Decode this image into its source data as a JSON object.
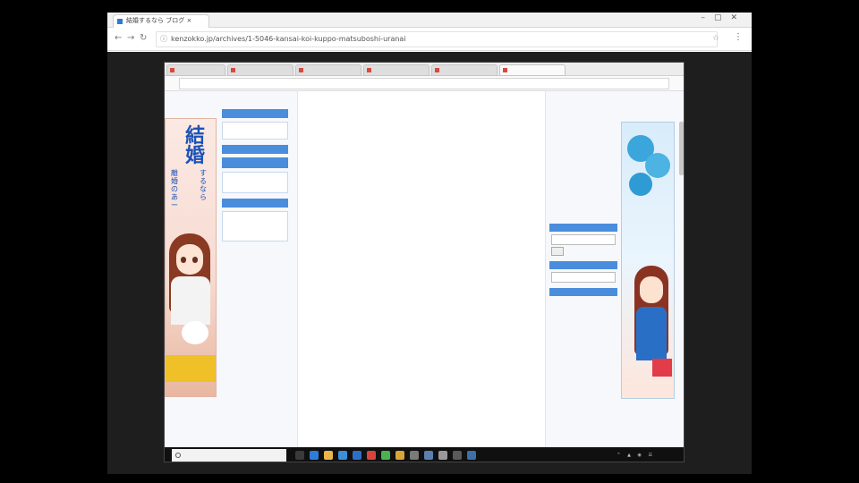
{
  "outer_browser": {
    "tab_title": "結婚するなら ブログ ×",
    "url": "kenzokko.jp/archives/1-5046-kansai-koi-kuppo-matsuboshi-uranai"
  },
  "inner_browser": {
    "tabs": [
      "",
      "",
      "",
      "",
      "",
      ""
    ],
    "url": ""
  },
  "left_banner": {
    "headline": "結婚",
    "subline": "するなら",
    "side_text": "離婚のあー",
    "bubble": "",
    "bottom_text": "",
    "caption": ""
  },
  "left_nav": {
    "headers": [
      "",
      "",
      ""
    ],
    "items": [
      "",
      "",
      "",
      "",
      "",
      "",
      "",
      ""
    ],
    "list": [
      "",
      "",
      "",
      "",
      "",
      "",
      "",
      "",
      "",
      "",
      "",
      "",
      ""
    ]
  },
  "article": {
    "title": "",
    "paragraphs": [
      {
        "text": "",
        "style": "normal"
      },
      {
        "text": "",
        "style": "normal"
      },
      {
        "text": "",
        "style": "normal"
      },
      {
        "text": "",
        "style": "normal"
      },
      {
        "text": "",
        "style": "red"
      },
      {
        "text": "",
        "style": "blue"
      },
      {
        "text": "",
        "style": "normal"
      },
      {
        "text": "",
        "style": "normal"
      },
      {
        "text": "",
        "style": "normal"
      },
      {
        "text": "",
        "style": "normal"
      },
      {
        "text": "",
        "style": "normal"
      },
      {
        "text": "",
        "style": "normal"
      },
      {
        "text": "",
        "style": "normal"
      },
      {
        "text": "",
        "style": "normal"
      }
    ]
  },
  "right_column": {
    "links": [
      "",
      "",
      "",
      "",
      "",
      "",
      "",
      "",
      "",
      "",
      ""
    ],
    "headers": [
      "",
      "",
      ""
    ],
    "bottom_links": [
      "",
      "",
      "",
      "",
      ""
    ]
  },
  "right_banner": {
    "badge": "",
    "caption": ""
  },
  "taskbar": {
    "search_placeholder": "",
    "time": "",
    "date": ""
  }
}
